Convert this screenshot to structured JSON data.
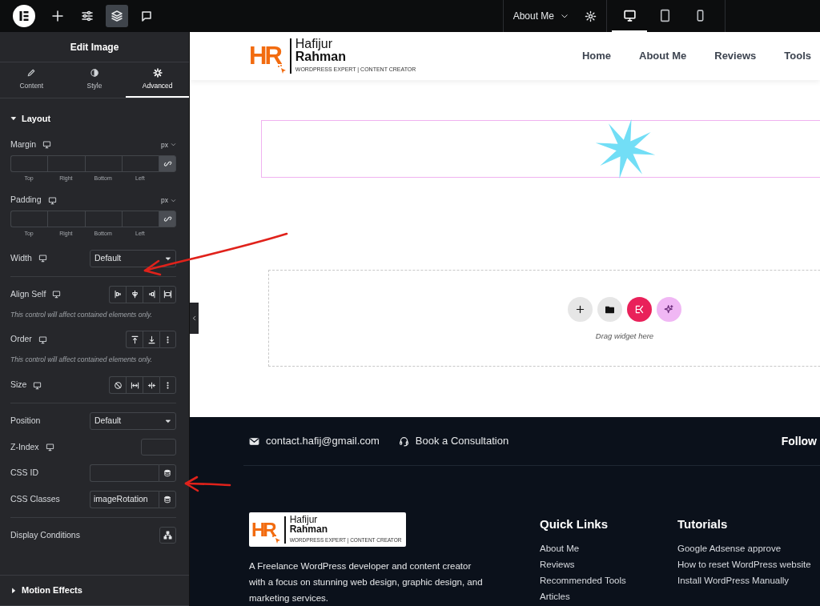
{
  "topbar": {
    "tools": [
      {
        "selected": false
      },
      {
        "selected": false
      },
      {
        "selected": true
      },
      {
        "selected": false
      }
    ],
    "page_menu": "About Me",
    "devices": [
      {
        "selected": true
      },
      {
        "selected": false
      },
      {
        "selected": false
      }
    ]
  },
  "panel": {
    "title": "Edit Image",
    "tabs": [
      {
        "label": "Content",
        "selected": false
      },
      {
        "label": "Style",
        "selected": false
      },
      {
        "label": "Advanced",
        "selected": true
      }
    ],
    "sections": [
      {
        "title": "Layout",
        "expanded": true,
        "controls": [
          {
            "kind": "dimensions",
            "label": "Margin",
            "responsive": true,
            "unit": "px",
            "sides": [
              "Top",
              "Right",
              "Bottom",
              "Left"
            ]
          },
          {
            "kind": "dimensions",
            "label": "Padding",
            "responsive": true,
            "unit": "px",
            "sides": [
              "Top",
              "Right",
              "Bottom",
              "Left"
            ]
          },
          {
            "kind": "select",
            "label": "Width",
            "responsive": true,
            "value": "Default"
          },
          {
            "kind": "divider"
          },
          {
            "kind": "align",
            "label": "Align Self",
            "responsive": true,
            "note": "This control will affect contained elements only."
          },
          {
            "kind": "order",
            "label": "Order",
            "responsive": true,
            "note": "This control will affect contained elements only."
          },
          {
            "kind": "size",
            "label": "Size",
            "responsive": true
          },
          {
            "kind": "divider"
          },
          {
            "kind": "select",
            "label": "Position",
            "responsive": false,
            "value": "Default"
          },
          {
            "kind": "number",
            "label": "Z-Index",
            "responsive": true
          },
          {
            "kind": "dynamic",
            "label": "CSS ID",
            "responsive": false
          },
          {
            "kind": "dynamic",
            "label": "CSS Classes",
            "responsive": false,
            "value": "imageRotation"
          },
          {
            "kind": "divider"
          },
          {
            "kind": "conditions",
            "label": "Display Conditions",
            "responsive": false
          }
        ]
      },
      {
        "title": "Motion Effects",
        "expanded": false
      }
    ]
  },
  "preview": {
    "header": {
      "logo": {
        "mark": "HR",
        "first": "Hafijur",
        "last": "Rahman",
        "tagline": "WORDPRESS EXPERT | CONTENT CREATOR"
      },
      "nav": [
        "Home",
        "About Me",
        "Reviews",
        "Tools"
      ]
    },
    "image_widget": {
      "selected": true
    },
    "drop_zone": {
      "hint": "Drag widget here"
    },
    "footer": {
      "contacts": [
        {
          "kind": "email",
          "text": "contact.hafij@gmail.com"
        },
        {
          "kind": "phone",
          "text": "Book a Consultation"
        }
      ],
      "follow": "Follow",
      "logo": {
        "mark": "HR",
        "first": "Hafijur",
        "last": "Rahman",
        "tagline": "WORDPRESS EXPERT | CONTENT CREATOR"
      },
      "description": "A Freelance WordPress developer and content creator with a focus on stunning web design, graphic design, and marketing services.",
      "columns": [
        {
          "title": "Quick Links",
          "links": [
            "About Me",
            "Reviews",
            "Recommended Tools",
            "Articles"
          ]
        },
        {
          "title": "Tutorials",
          "links": [
            "Google Adsense approve",
            "How to reset WordPress website",
            "Install WordPress Manually"
          ]
        }
      ]
    }
  }
}
